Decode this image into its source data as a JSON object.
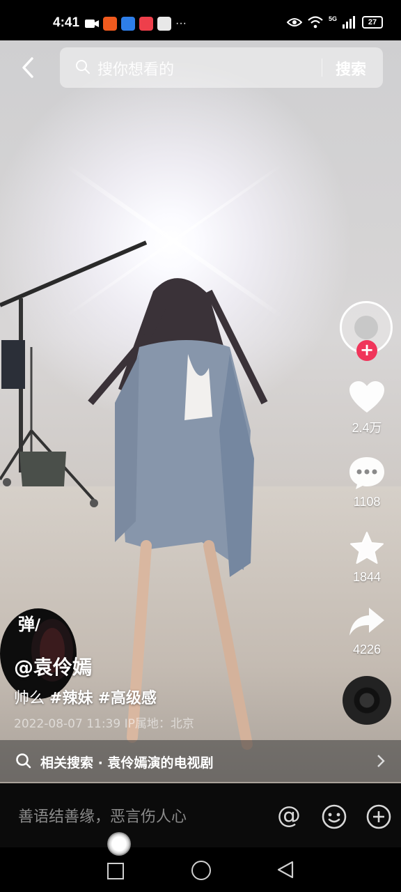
{
  "status_bar": {
    "time": "4:41",
    "network": "5G",
    "battery": "27",
    "more": "···",
    "app_icon_colors": [
      "#f05a1e",
      "#2e7ee8",
      "#ee3f4b",
      "#e8e8e8"
    ]
  },
  "header": {
    "search_placeholder": "搜你想看的",
    "search_button": "搜索"
  },
  "sidebar": {
    "likes": "2.4万",
    "comments": "1108",
    "favorites": "1844",
    "shares": "4226",
    "follow_plus": "+",
    "accent_color": "#f0355a"
  },
  "video_info": {
    "danmaku_label": "弹",
    "author": "@袁伶嫣",
    "caption_text": "帅么",
    "tags": [
      "#辣妹",
      "#高级感"
    ],
    "date": "2022-08-07 11:39",
    "ip_location": "IP属地：北京"
  },
  "related_search": {
    "label": "相关搜索 · 袁伶嫣演的电视剧"
  },
  "comment_bar": {
    "placeholder": "善语结善缘，恶言伤人心",
    "at_symbol": "@"
  }
}
